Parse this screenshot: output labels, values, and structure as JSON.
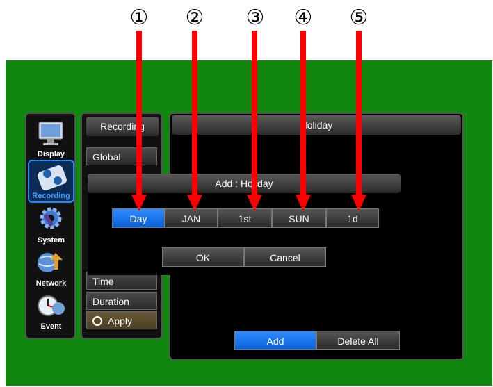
{
  "sidebar": {
    "items": [
      {
        "label": "Display",
        "icon": "monitor-icon"
      },
      {
        "label": "Recording",
        "icon": "recording-icon",
        "active": true
      },
      {
        "label": "System",
        "icon": "gear-icon"
      },
      {
        "label": "Network",
        "icon": "network-icon"
      },
      {
        "label": "Event",
        "icon": "clock-icon"
      }
    ]
  },
  "menu": {
    "title": "Recording",
    "items": [
      "Global",
      "Time",
      "Duration"
    ],
    "apply_label": "Apply"
  },
  "panel": {
    "title": "Holiday",
    "add_label": "Add",
    "delete_all_label": "Delete All"
  },
  "dialog": {
    "title": "Add : Holiday",
    "fields": [
      "Day",
      "JAN",
      "1st",
      "SUN",
      "1d"
    ],
    "ok_label": "OK",
    "cancel_label": "Cancel"
  },
  "annotations": [
    "①",
    "②",
    "③",
    "④",
    "⑤"
  ],
  "colors": {
    "background": "#108810",
    "accent": "#1c8cff",
    "arrow": "#ff0000"
  }
}
